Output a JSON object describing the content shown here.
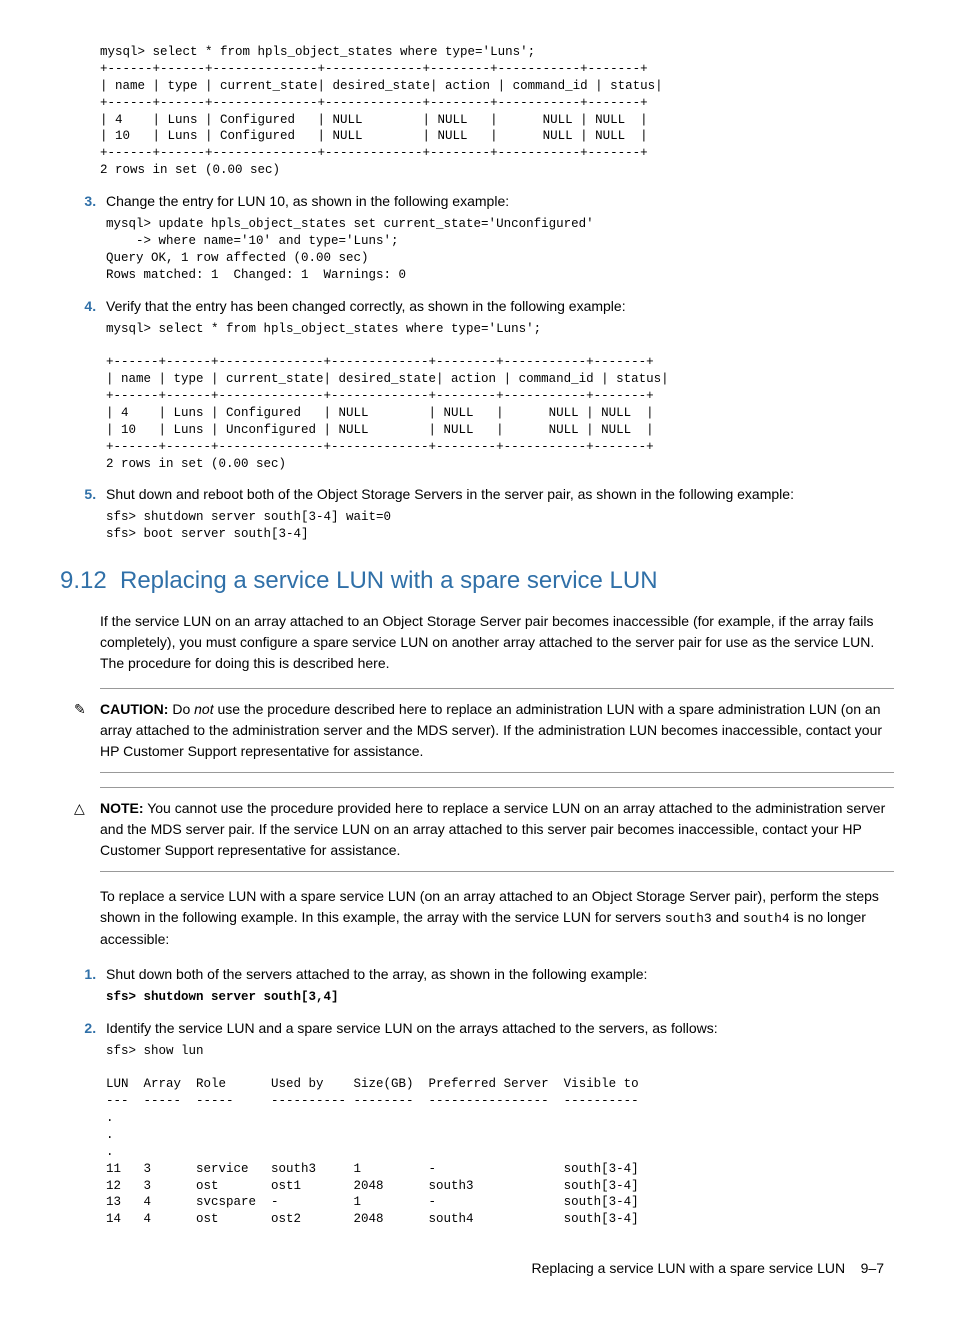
{
  "code_block_1": "mysql> select * from hpls_object_states where type='Luns';\n+------+------+--------------+-------------+--------+-----------+-------+\n| name | type | current_state| desired_state| action | command_id | status|\n+------+------+--------------+-------------+--------+-----------+-------+\n| 4    | Luns | Configured   | NULL        | NULL   |      NULL | NULL  |\n| 10   | Luns | Configured   | NULL        | NULL   |      NULL | NULL  |\n+------+------+--------------+-------------+--------+-----------+-------+\n2 rows in set (0.00 sec)",
  "step3_text": "Change the entry for LUN 10, as shown in the following example:",
  "code_block_2": "mysql> update hpls_object_states set current_state='Unconfigured'\n    -> where name='10' and type='Luns';\nQuery OK, 1 row affected (0.00 sec)\nRows matched: 1  Changed: 1  Warnings: 0",
  "step4_text": "Verify that the entry has been changed correctly, as shown in the following example:",
  "code_block_3": "mysql> select * from hpls_object_states where type='Luns';\n\n+------+------+--------------+-------------+--------+-----------+-------+\n| name | type | current_state| desired_state| action | command_id | status|\n+------+------+--------------+-------------+--------+-----------+-------+\n| 4    | Luns | Configured   | NULL        | NULL   |      NULL | NULL  |\n| 10   | Luns | Unconfigured | NULL        | NULL   |      NULL | NULL  |\n+------+------+--------------+-------------+--------+-----------+-------+\n2 rows in set (0.00 sec)",
  "step5_text": "Shut down and reboot both of the Object Storage Servers in the server pair, as shown in the following example:",
  "code_block_4": "sfs> shutdown server south[3-4] wait=0\nsfs> boot server south[3-4]",
  "heading_num": "9.12",
  "heading_text": "Replacing a service LUN with a spare service LUN",
  "intro_para": "If the service LUN on an array attached to an Object Storage Server pair becomes inaccessible (for example, if the array fails completely), you must configure a spare service LUN on another array attached to the server pair for use as the service LUN. The procedure for doing this is described here.",
  "caution_label": "CAUTION:",
  "caution_text_start": "  Do ",
  "caution_text_not": "not",
  "caution_text_end": " use the procedure described here to replace an administration LUN with a spare administration LUN (on an array attached to the administration server and the MDS server). If the administration LUN becomes inaccessible, contact your HP Customer Support representative for assistance.",
  "note_label": "NOTE:",
  "note_text": "  You cannot use the procedure provided here to replace a service LUN on an array attached to the administration server and the MDS server pair. If the service LUN on an array attached to this server pair becomes inaccessible, contact your HP Customer Support representative for assistance.",
  "proc_intro_1": "To replace a service LUN with a spare service LUN (on an array attached to an Object Storage Server pair), perform the steps shown in the following example. In this example, the array with the service LUN for servers ",
  "proc_mono_1": "south3",
  "proc_intro_2": " and ",
  "proc_mono_2": "south4",
  "proc_intro_3": " is no longer accessible:",
  "step1_text": "Shut down both of the servers attached to the array, as shown in the following example:",
  "code_block_5": "sfs> shutdown server south[3,4]",
  "step2_text": "Identify the service LUN and a spare service LUN on the arrays attached to the servers, as follows:",
  "code_block_6": "sfs> show lun\n\nLUN  Array  Role      Used by    Size(GB)  Preferred Server  Visible to\n---  -----  -----     ---------- --------  ----------------  ----------\n.\n.\n.\n11   3      service   south3     1         -                 south[3-4]\n12   3      ost       ost1       2048      south3            south[3-4]\n13   4      svcspare  -          1         -                 south[3-4]\n14   4      ost       ost2       2048      south4            south[3-4]",
  "footer_text": "Replacing a service LUN with a spare service LUN",
  "footer_page": "9–7"
}
